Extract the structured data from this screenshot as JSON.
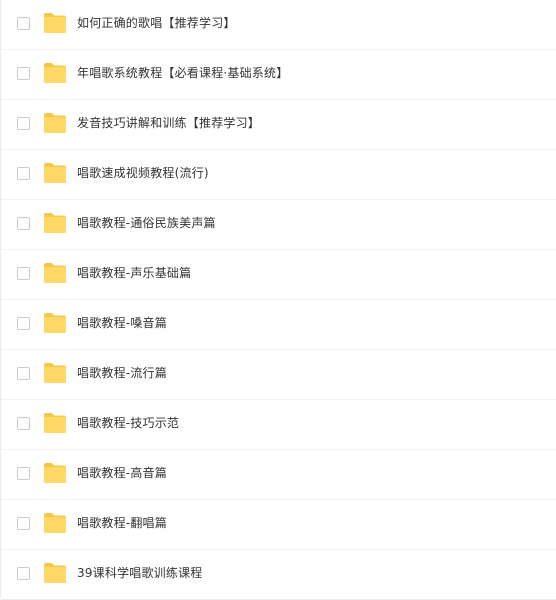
{
  "file_list": {
    "items": [
      {
        "name": "如何正确的歌唱【推荐学习】",
        "icon": "folder-icon"
      },
      {
        "name": "年唱歌系统教程【必看课程·基础系统】",
        "icon": "folder-icon"
      },
      {
        "name": "发音技巧讲解和训练【推荐学习】",
        "icon": "folder-icon"
      },
      {
        "name": "唱歌速成视频教程(流行)",
        "icon": "folder-icon"
      },
      {
        "name": "唱歌教程-通俗民族美声篇",
        "icon": "folder-icon"
      },
      {
        "name": "唱歌教程-声乐基础篇",
        "icon": "folder-icon"
      },
      {
        "name": "唱歌教程-嗓音篇",
        "icon": "folder-icon"
      },
      {
        "name": "唱歌教程-流行篇",
        "icon": "folder-icon"
      },
      {
        "name": "唱歌教程-技巧示范",
        "icon": "folder-icon"
      },
      {
        "name": "唱歌教程-高音篇",
        "icon": "folder-icon"
      },
      {
        "name": "唱歌教程-翻唱篇",
        "icon": "folder-icon"
      },
      {
        "name": "39课科学唱歌训练课程",
        "icon": "folder-icon"
      }
    ]
  },
  "colors": {
    "folder_body": "#FFD866",
    "folder_tab": "#F5C84C",
    "text": "#333333",
    "divider": "#F0F2F5"
  }
}
